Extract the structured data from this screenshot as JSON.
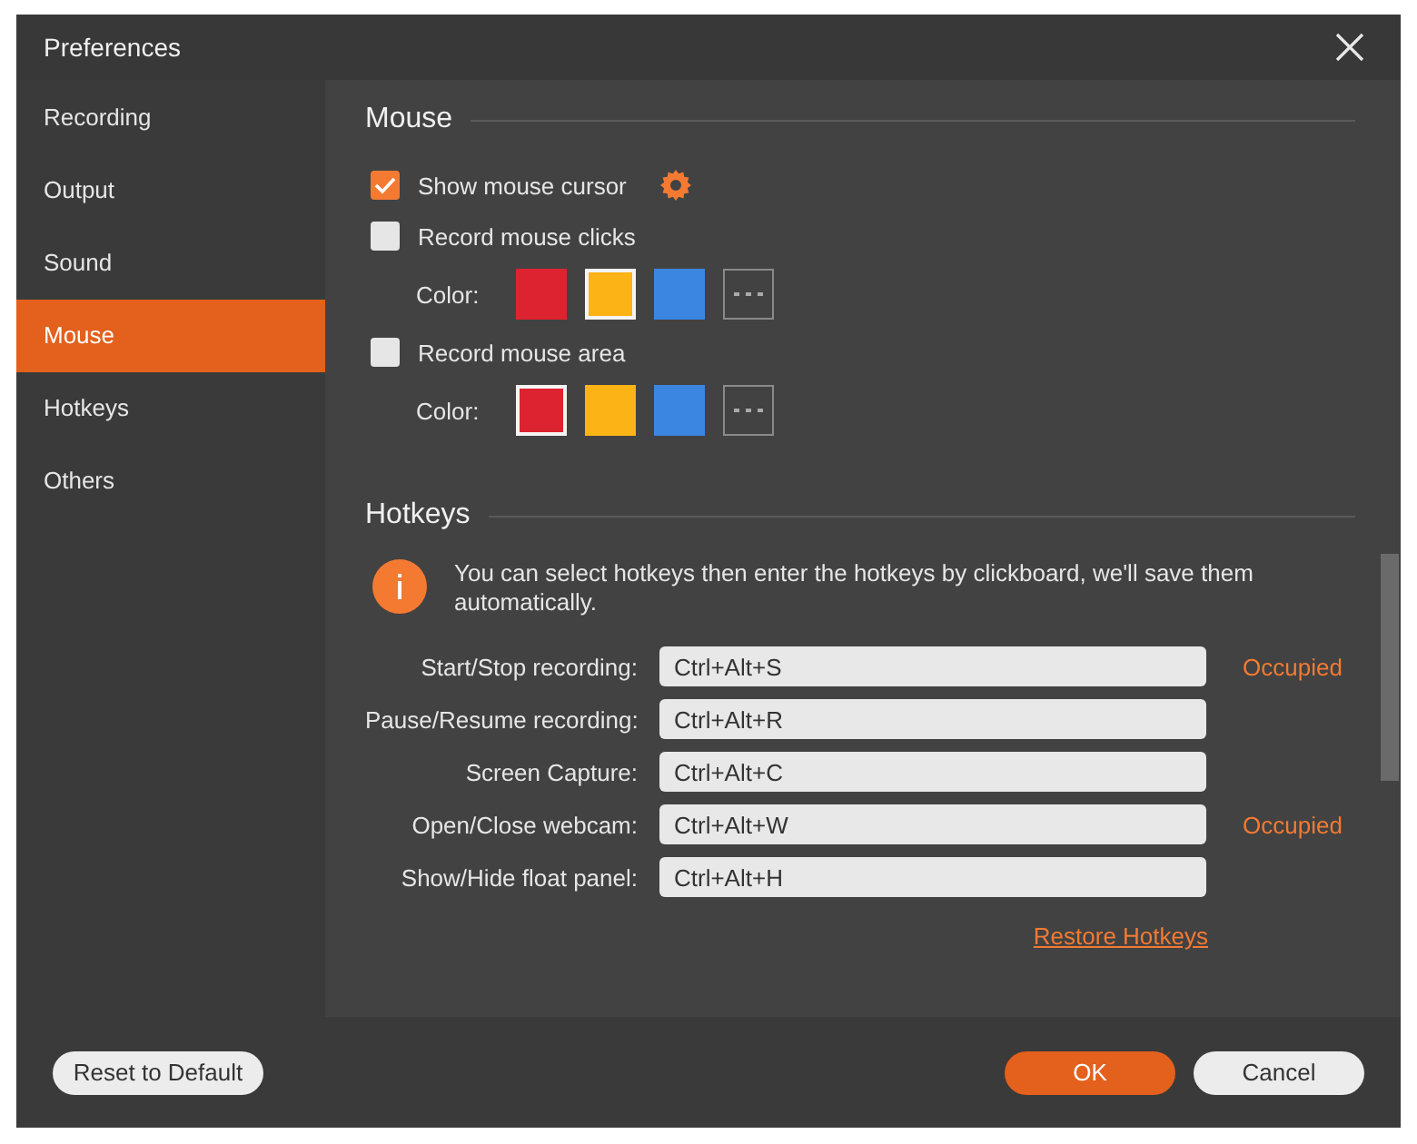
{
  "window": {
    "title": "Preferences"
  },
  "sidebar": {
    "items": [
      {
        "label": "Recording",
        "selected": false
      },
      {
        "label": "Output",
        "selected": false
      },
      {
        "label": "Sound",
        "selected": false
      },
      {
        "label": "Mouse",
        "selected": true
      },
      {
        "label": "Hotkeys",
        "selected": false
      },
      {
        "label": "Others",
        "selected": false
      }
    ]
  },
  "mouse": {
    "title": "Mouse",
    "rows": [
      {
        "kind": "checkbox",
        "label": "Show mouse cursor",
        "checked": true,
        "settings": true
      },
      {
        "kind": "checkbox",
        "label": "Record mouse clicks",
        "checked": false
      },
      {
        "kind": "colors",
        "label": "Color:",
        "swatches": [
          {
            "color": "#dd2330",
            "selected": false
          },
          {
            "color": "#fbb316",
            "selected": true
          },
          {
            "color": "#3a86e0",
            "selected": false
          }
        ]
      },
      {
        "kind": "checkbox",
        "label": "Record mouse area",
        "checked": false
      },
      {
        "kind": "colors",
        "label": "Color:",
        "swatches": [
          {
            "color": "#dd2330",
            "selected": true
          },
          {
            "color": "#fbb316",
            "selected": false
          },
          {
            "color": "#3a86e0",
            "selected": false
          }
        ]
      }
    ]
  },
  "hotkeys": {
    "title": "Hotkeys",
    "info": "You can select hotkeys then enter the hotkeys by clickboard, we'll save them automatically.",
    "rows": [
      {
        "label": "Start/Stop recording:",
        "value": "Ctrl+Alt+S",
        "status": "Occupied"
      },
      {
        "label": "Pause/Resume recording:",
        "value": "Ctrl+Alt+R"
      },
      {
        "label": "Screen Capture:",
        "value": "Ctrl+Alt+C"
      },
      {
        "label": "Open/Close webcam:",
        "value": "Ctrl+Alt+W",
        "status": "Occupied"
      },
      {
        "label": "Show/Hide float panel:",
        "value": "Ctrl+Alt+H"
      }
    ],
    "link": "Restore Hotkeys"
  },
  "footer": {
    "reset": "Reset to Default",
    "ok": "OK",
    "cancel": "Cancel"
  }
}
